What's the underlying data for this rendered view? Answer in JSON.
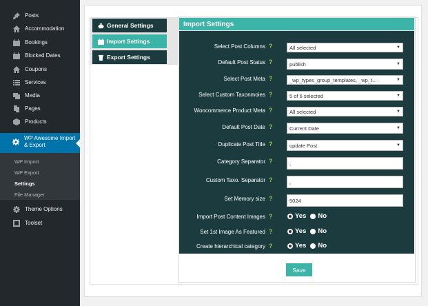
{
  "sidebar": {
    "items": [
      {
        "label": "Posts",
        "icon": "pin-icon"
      },
      {
        "label": "Accommodation",
        "icon": "home-icon"
      },
      {
        "label": "Bookings",
        "icon": "calendar-icon"
      },
      {
        "label": "Blocked Dates",
        "icon": "calendar-icon"
      },
      {
        "label": "Coupons",
        "icon": "home-icon"
      },
      {
        "label": "Services",
        "icon": "list-icon"
      },
      {
        "label": "Media",
        "icon": "media-icon"
      },
      {
        "label": "Pages",
        "icon": "pages-icon"
      },
      {
        "label": "Products",
        "icon": "cube-icon"
      }
    ],
    "active": {
      "label": "WP Awesome Import & Export",
      "icon": "gear-icon"
    },
    "submenu": [
      "WP Import",
      "WP Export",
      "Settings",
      "File Manager"
    ],
    "bottom_items": [
      {
        "label": "Theme Options",
        "icon": "gear-icon"
      },
      {
        "label": "Toolset",
        "icon": "toolset-icon"
      }
    ]
  },
  "tabs": [
    {
      "label": "General Settings",
      "icon": "ship-icon"
    },
    {
      "label": "Import Settings",
      "icon": "calendar-icon"
    },
    {
      "label": "Export Settings",
      "icon": "trash-icon"
    }
  ],
  "panel": {
    "title": "Import Settings",
    "fields": [
      {
        "label": "Select Post Columns",
        "value": "All selected"
      },
      {
        "label": "Default Post Status",
        "value": "publish"
      },
      {
        "label": "Select Post Meta",
        "value": "_wp_types_group_templates, _wp_t..."
      },
      {
        "label": "Select Custom Taxonmoies",
        "value": "5 of 6 selected"
      },
      {
        "label": "Woocommerce Product Meta",
        "value": "All selected"
      },
      {
        "label": "Default Post Date",
        "value": "Current Date"
      },
      {
        "label": "Duplicate Post Title",
        "value": "update Post"
      },
      {
        "label": "Category Separator",
        "value": ";"
      },
      {
        "label": "Custom Taxo. Separator",
        "value": ","
      },
      {
        "label": "Set Memory size",
        "value": "5024"
      }
    ],
    "radios": [
      {
        "label": "Import Post Content Images",
        "yes": "Yes",
        "no": "No"
      },
      {
        "label": "Set 1st Image As Featured",
        "yes": "Yes",
        "no": "No"
      },
      {
        "label": "Create hierarchical category",
        "yes": "Yes",
        "no": "No"
      }
    ],
    "help": "?",
    "save_label": "Save"
  },
  "colors": {
    "sidebar": "#23282d",
    "accent": "#3cb4a7",
    "panel": "#1c3b3f",
    "active_menu": "#0073aa",
    "help": "#8bc34a"
  }
}
